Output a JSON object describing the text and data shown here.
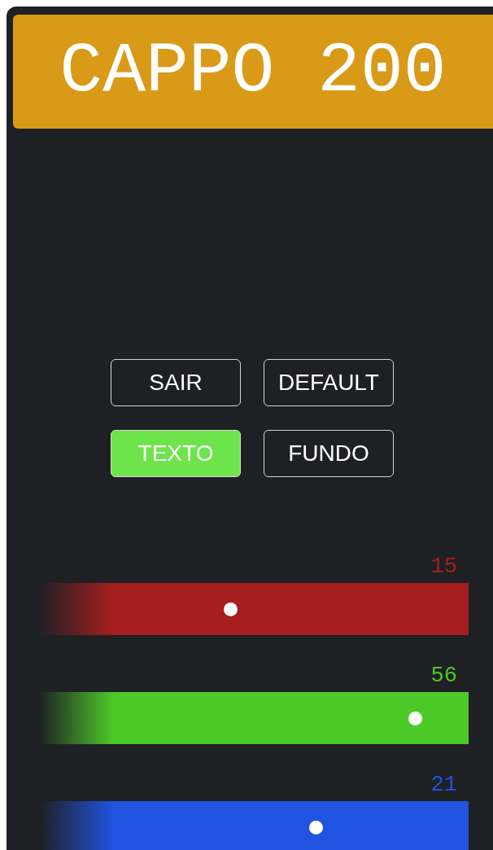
{
  "header": {
    "title": "CAPPO 200"
  },
  "buttons": [
    {
      "label": "SAIR",
      "selected": false
    },
    {
      "label": "DEFAULT",
      "selected": false
    },
    {
      "label": "TEXTO",
      "selected": true
    },
    {
      "label": "FUNDO",
      "selected": false
    }
  ],
  "sliders": [
    {
      "reading": "15",
      "color": "#a61e1e",
      "level": 0.445
    },
    {
      "reading": "56",
      "color": "#4cca28",
      "level": 0.875
    },
    {
      "reading": "21",
      "color": "#1f53e0",
      "level": 0.644
    }
  ]
}
